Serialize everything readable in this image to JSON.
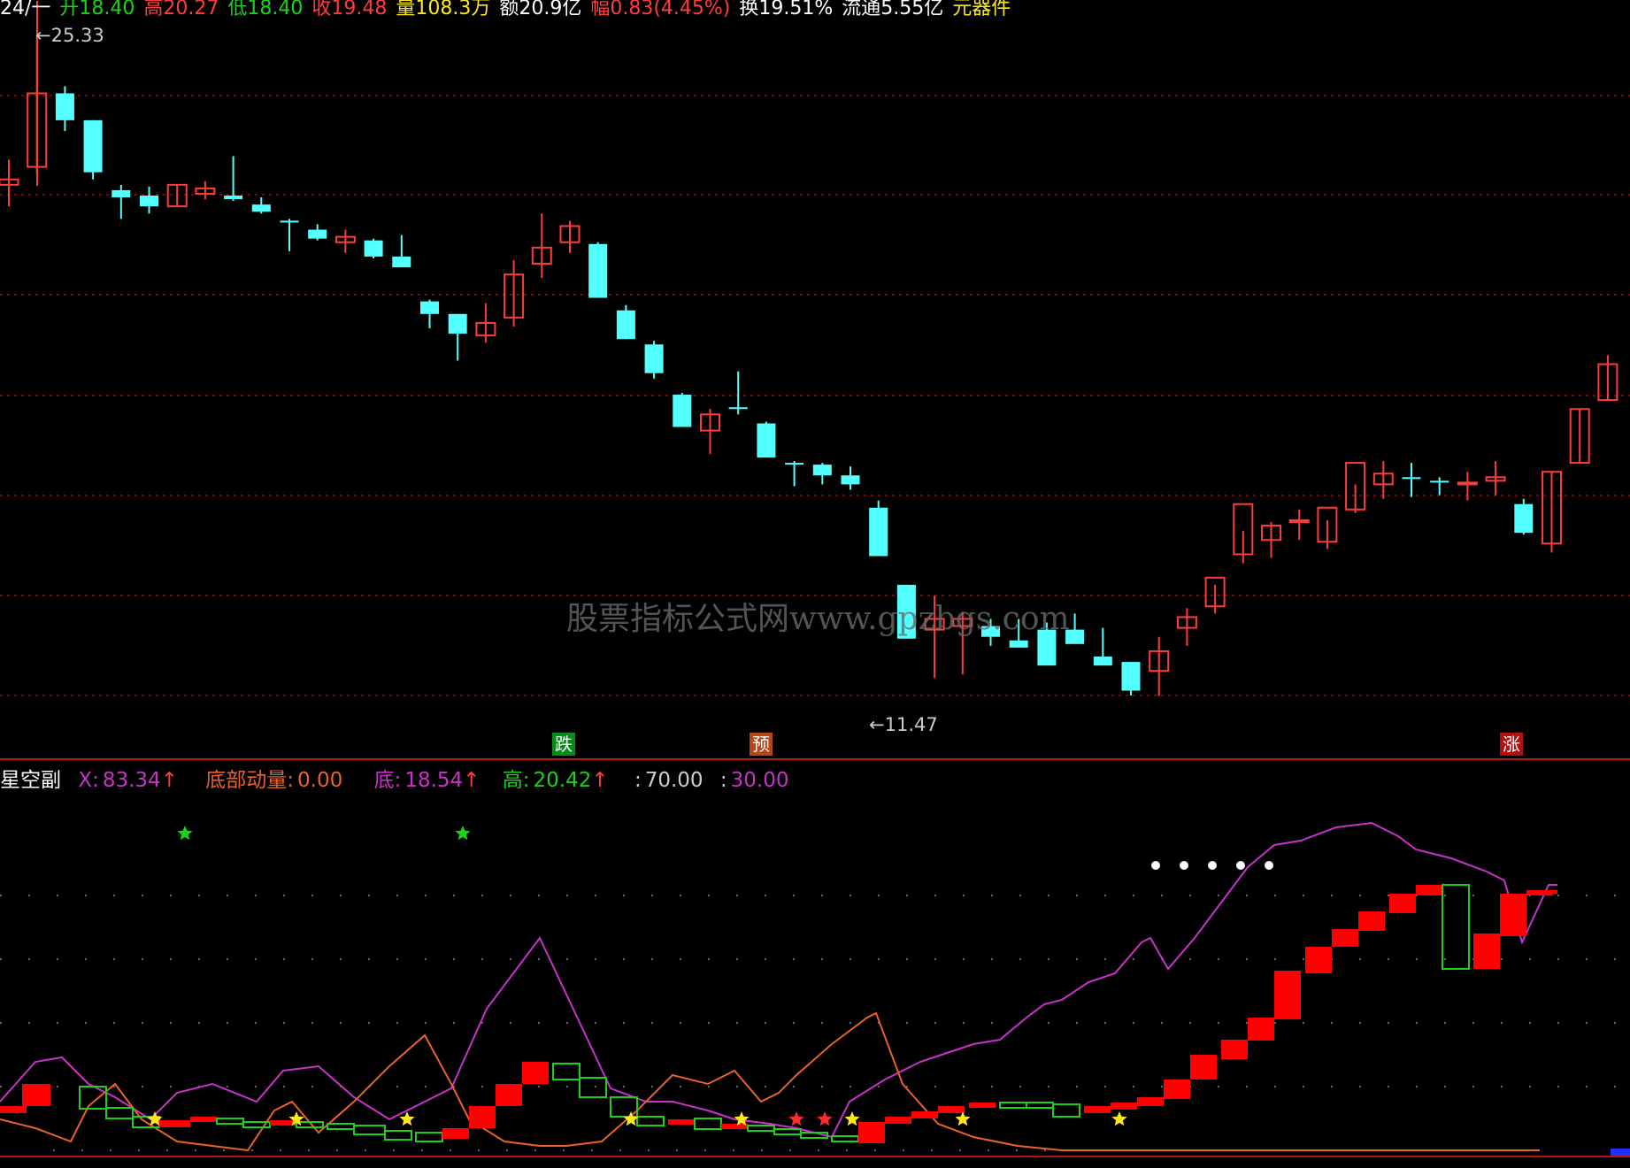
{
  "header": {
    "date": "24/一",
    "open": "开18.40",
    "high": "高20.27",
    "low": "低18.40",
    "close": "收19.48",
    "volume": "量108.3万",
    "amount": "额20.9亿",
    "range": "幅0.83(4.45%)",
    "turnover": "换19.51%",
    "float": "流通5.55亿",
    "sector": "元器件"
  },
  "main_chart": {
    "price_high_label": "25.33",
    "price_low_label": "11.47",
    "signals": [
      {
        "text": "跌",
        "color": "#0a8a1a"
      },
      {
        "text": "预",
        "color": "#b5451b"
      },
      {
        "text": "涨",
        "color": "#b01010"
      }
    ],
    "watermark": "股票指标公式网www.gpzbgs.com"
  },
  "indicator": {
    "name": "星空副",
    "x_label": "X:",
    "x_value": "83.34",
    "momentum_label": "底部动量:",
    "momentum_value": "0.00",
    "bottom_label": "底:",
    "bottom_value": "18.54",
    "top_label": "高:",
    "top_value": "20.42",
    "line1_label": ":",
    "line1_value": "70.00",
    "line2_label": ":",
    "line2_value": "30.00"
  },
  "colors": {
    "up": "#ff3c3c",
    "down": "#54ffff",
    "grid": "#8a1010",
    "magenta": "#c832c8",
    "orange": "#e8622a",
    "green": "#1bd21b",
    "yellow": "#ffe81a"
  },
  "chart_data": {
    "type": "candlestick",
    "ohlc": [
      [
        17.0,
        18.4,
        15.8,
        17.3
      ],
      [
        18.0,
        25.33,
        17.6,
        22.1
      ],
      [
        22.1,
        22.5,
        20.0,
        20.6
      ],
      [
        20.6,
        20.6,
        17.3,
        17.7
      ],
      [
        16.7,
        17.0,
        15.1,
        16.3
      ],
      [
        16.4,
        16.9,
        15.4,
        15.8
      ],
      [
        15.8,
        17.0,
        15.8,
        17.0
      ],
      [
        16.5,
        17.2,
        16.2,
        16.8
      ],
      [
        16.4,
        18.6,
        16.1,
        16.2
      ],
      [
        15.9,
        16.3,
        15.4,
        15.5
      ],
      [
        15.0,
        15.1,
        13.3,
        14.9
      ],
      [
        14.5,
        14.8,
        13.9,
        14.0
      ],
      [
        13.8,
        14.5,
        13.2,
        14.1
      ],
      [
        13.9,
        14.0,
        12.9,
        13.0
      ],
      [
        13.0,
        14.2,
        12.6,
        12.4
      ],
      [
        10.5,
        10.6,
        9.0,
        9.8
      ],
      [
        9.8,
        9.8,
        7.2,
        8.7
      ],
      [
        8.6,
        10.4,
        8.2,
        9.3
      ],
      [
        9.6,
        12.8,
        9.1,
        12.0
      ],
      [
        12.6,
        15.4,
        11.8,
        13.5
      ],
      [
        13.8,
        15.0,
        13.2,
        14.7
      ],
      [
        13.7,
        13.8,
        10.9,
        10.7
      ],
      [
        10.0,
        10.3,
        8.4,
        8.4
      ],
      [
        8.1,
        8.3,
        6.2,
        6.5
      ],
      [
        5.3,
        5.4,
        3.5,
        3.5
      ],
      [
        3.3,
        4.5,
        2.0,
        4.2
      ],
      [
        4.6,
        6.6,
        4.2,
        4.5
      ],
      [
        3.7,
        3.8,
        1.8,
        1.8
      ],
      [
        1.5,
        1.6,
        0.2,
        1.4
      ],
      [
        1.4,
        1.5,
        0.3,
        0.8
      ],
      [
        0.8,
        1.3,
        0.0,
        0.3
      ],
      [
        -1.0,
        -0.6,
        -3.7,
        -3.7
      ],
      [
        -5.3,
        -5.3,
        -8.3,
        -8.3
      ],
      [
        -7.8,
        -5.9,
        -10.5,
        -7.2
      ],
      [
        -7.6,
        -6.8,
        -10.3,
        -7.2
      ],
      [
        -7.6,
        -7.2,
        -8.7,
        -8.2
      ],
      [
        -8.4,
        -7.2,
        -8.6,
        -8.8
      ],
      [
        -7.8,
        -7.4,
        -9.7,
        -9.8
      ],
      [
        -7.8,
        -6.9,
        -8.3,
        -8.6
      ],
      [
        -9.3,
        -7.7,
        -9.5,
        -9.8
      ],
      [
        -9.6,
        -9.6,
        -11.47,
        -11.2
      ],
      [
        -10.1,
        -8.2,
        -11.5,
        -9.0
      ],
      [
        -7.7,
        -6.6,
        -8.7,
        -7.1
      ],
      [
        -6.5,
        -5.3,
        -6.9,
        -4.9
      ],
      [
        -3.6,
        -2.3,
        -4.1,
        -0.8
      ],
      [
        -2.8,
        -1.8,
        -3.8,
        -2.0
      ],
      [
        -1.8,
        -1.1,
        -2.8,
        -1.7
      ],
      [
        -2.9,
        -1.7,
        -3.3,
        -1.0
      ],
      [
        -1.1,
        0.3,
        -1.3,
        1.5
      ],
      [
        0.3,
        1.6,
        -0.5,
        0.9
      ],
      [
        0.7,
        1.5,
        -0.4,
        0.6
      ],
      [
        0.5,
        0.7,
        -0.3,
        0.4
      ],
      [
        0.3,
        1.0,
        -0.6,
        0.4
      ],
      [
        0.5,
        1.6,
        -0.3,
        0.7
      ],
      [
        -0.8,
        -0.5,
        -2.5,
        -2.4
      ],
      [
        -3.0,
        1.0,
        -3.5,
        1.0
      ],
      [
        1.5,
        4.5,
        1.5,
        4.5
      ],
      [
        5.0,
        7.5,
        5.0,
        7.0
      ]
    ]
  }
}
